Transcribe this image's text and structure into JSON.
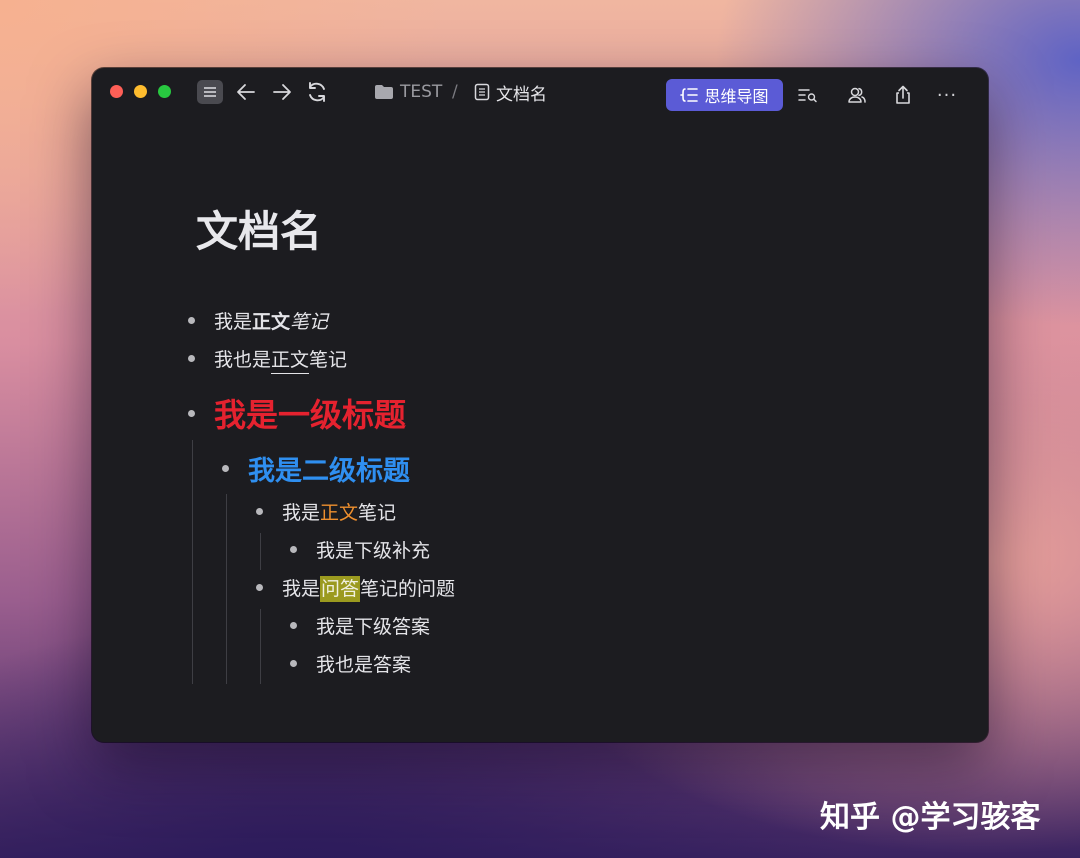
{
  "titlebar": {
    "breadcrumb": {
      "folder": "TEST",
      "separator": "/",
      "document": "文档名"
    },
    "mindmap_label": "思维导图",
    "more_label": "···"
  },
  "document": {
    "title": "文档名",
    "lines": [
      {
        "a": "我是",
        "b": "正文",
        "c": "笔记"
      },
      {
        "a": "我也是",
        "b": "正文",
        "c": "笔记"
      },
      {
        "text": "我是一级标题",
        "color": "#e5222f"
      },
      {
        "text": "我是二级标题",
        "color": "#2f8ff0"
      },
      {
        "a": "我是",
        "b": "正文",
        "c": "笔记",
        "b_color": "#ee8f2e"
      },
      {
        "text": "我是下级补充"
      },
      {
        "a": "我是",
        "b": "问答",
        "c": "笔记的问题",
        "b_highlight": "#9b9a1f"
      },
      {
        "text": "我是下级答案"
      },
      {
        "text": "我也是答案"
      }
    ]
  },
  "watermark": "知乎 @学习骇客"
}
